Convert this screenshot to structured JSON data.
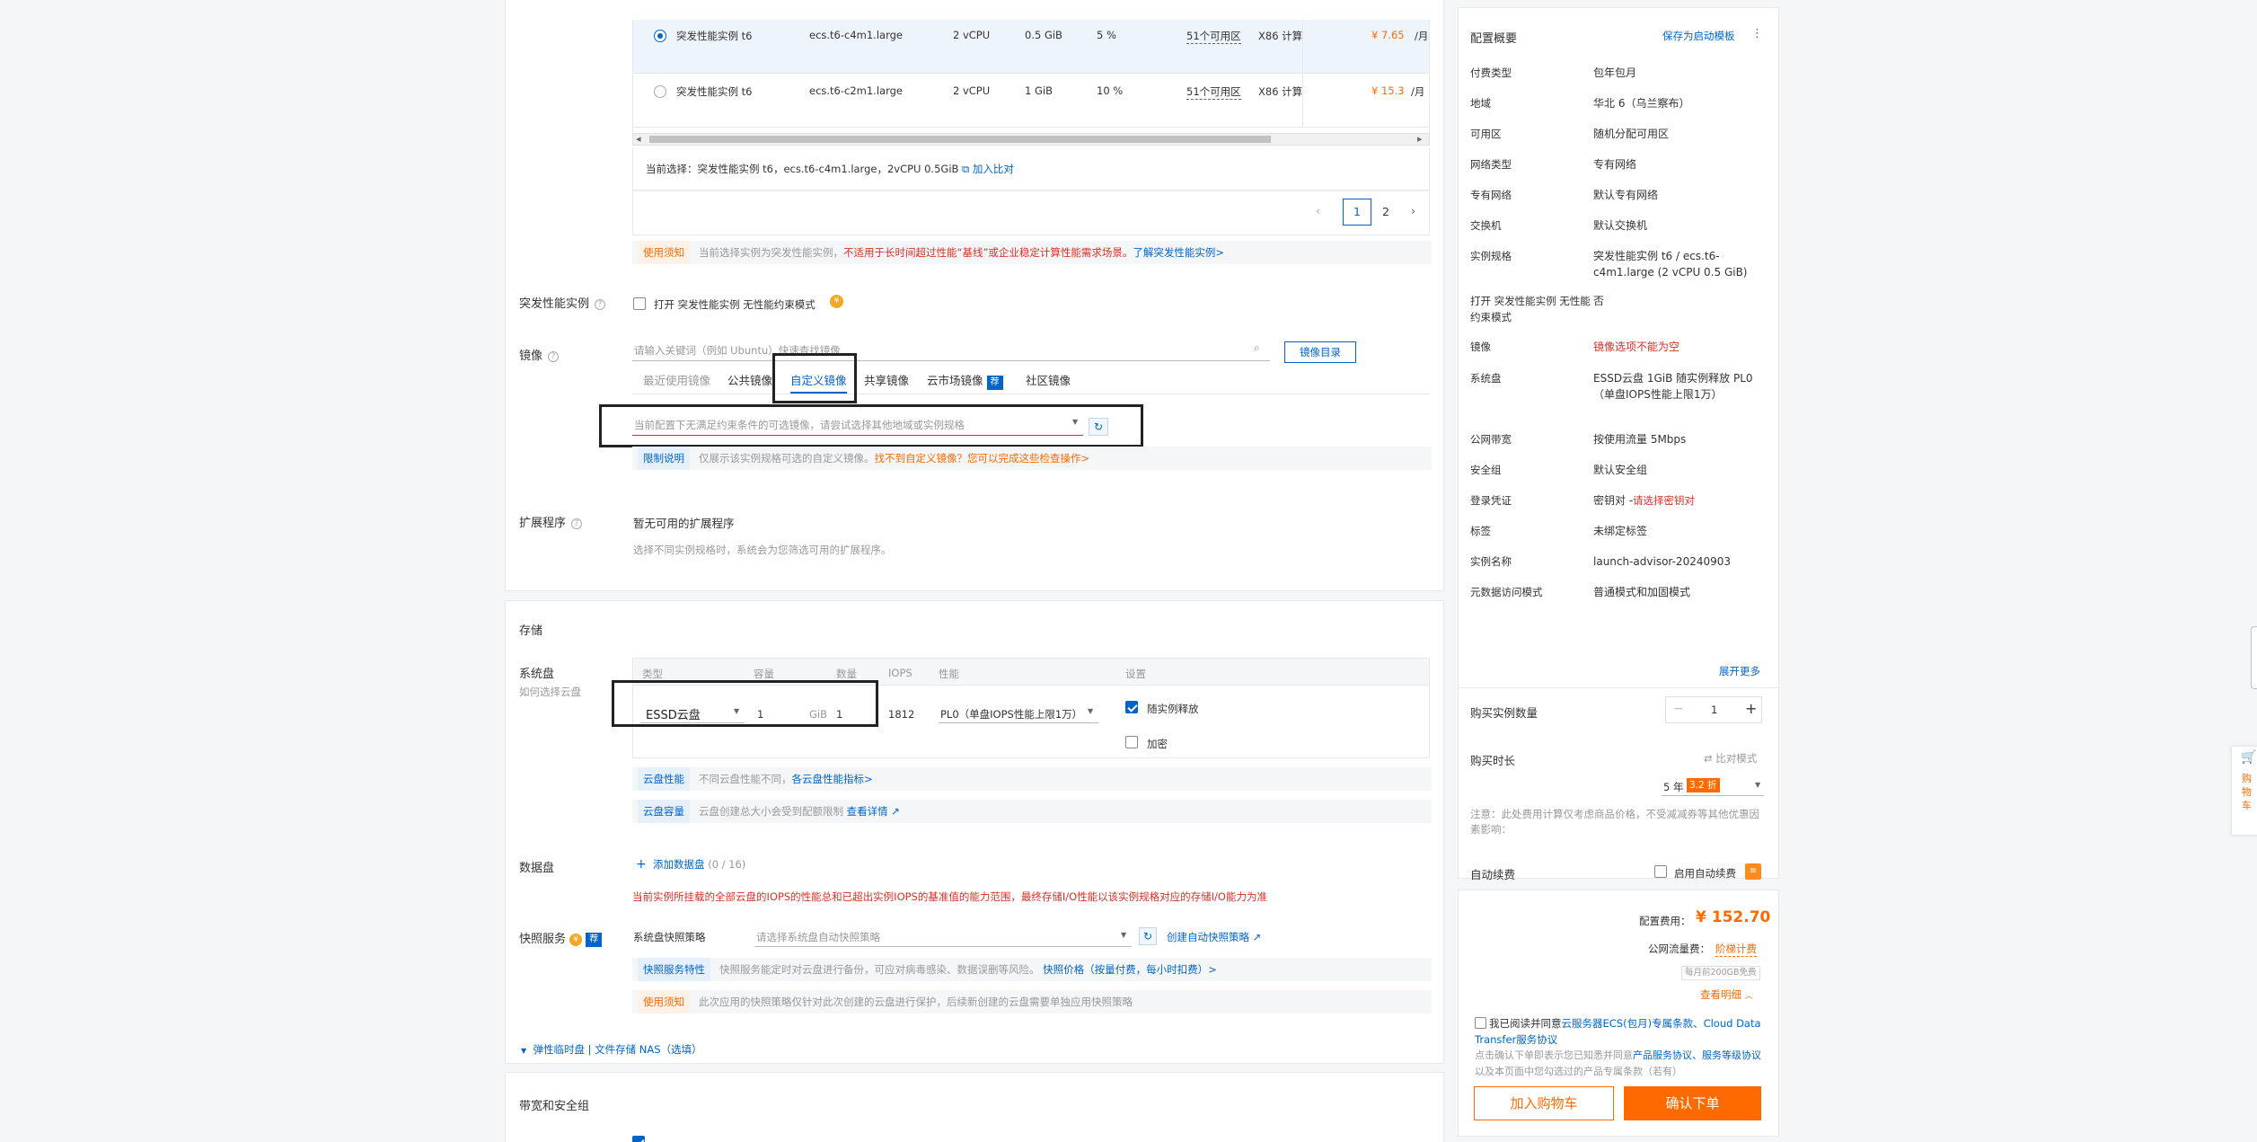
{
  "instance_table": {
    "rows": [
      {
        "family": "突发性能实例 t6",
        "spec": "ecs.t6-c4m1.large",
        "vcpu": "2 vCPU",
        "mem": "0.5 GiB",
        "baseline": "5 %",
        "zones": "51个可用区",
        "arch": "X86 计算",
        "price": "¥ 7.65",
        "unit": "/月",
        "selected": true
      },
      {
        "family": "突发性能实例 t6",
        "spec": "ecs.t6-c2m1.large",
        "vcpu": "2 vCPU",
        "mem": "1 GiB",
        "baseline": "10 %",
        "zones": "51个可用区",
        "arch": "X86 计算",
        "price": "¥ 15.3",
        "unit": "/月",
        "selected": false
      }
    ],
    "current_selection": "当前选择：突发性能实例 t6，ecs.t6-c4m1.large，2vCPU 0.5GiB",
    "add_compare": "加入比对",
    "pages": [
      "1",
      "2"
    ],
    "current_page": "1"
  },
  "notices": {
    "usage_tag": "使用须知",
    "usage_text_1": "当前选择实例为突发性能实例，",
    "usage_text_red": "不适用于长时间超过性能“基线”或企业稳定计算性能需求场景。",
    "usage_link": "了解突发性能实例>"
  },
  "burst": {
    "label": "突发性能实例",
    "checkbox_label": "打开 突发性能实例 无性能约束模式"
  },
  "image": {
    "label": "镜像",
    "search_placeholder": "请输入关键词（例如 Ubuntu）快速查找镜像",
    "catalog_button": "镜像目录",
    "tabs": [
      "最近使用镜像",
      "公共镜像",
      "自定义镜像",
      "共享镜像",
      "云市场镜像",
      "社区镜像"
    ],
    "market_badge": "荐",
    "select_placeholder": "当前配置下无满足约束条件的可选镜像，请尝试选择其他地域或实例规格",
    "limit_tag": "限制说明",
    "limit_text": "仅展示该实例规格可选的自定义镜像。",
    "limit_text_orange": "找不到自定义镜像？您可以完成这些检查操作>"
  },
  "extensions": {
    "label": "扩展程序",
    "title": "暂无可用的扩展程序",
    "desc": "选择不同实例规格时，系统会为您筛选可用的扩展程序。"
  },
  "storage": {
    "title": "存储",
    "system_disk_label": "系统盘",
    "system_disk_help": "如何选择云盘",
    "headers": [
      "类型",
      "容量",
      "数量",
      "IOPS",
      "性能",
      "设置"
    ],
    "disk_type": "ESSD云盘",
    "capacity": "1",
    "capacity_unit": "GiB",
    "count": "1",
    "iops": "1812",
    "perf": "PL0（单盘IOPS性能上限1万）",
    "release_with_instance": "随实例释放",
    "encrypt": "加密",
    "perf_tag": "云盘性能",
    "perf_text": "不同云盘性能不同，",
    "perf_link": "各云盘性能指标>",
    "cap_tag": "云盘容量",
    "cap_text": "云盘创建总大小会受到配额限制",
    "cap_link": "查看详情",
    "data_disk_label": "数据盘",
    "add_data_disk": "添加数据盘",
    "data_disk_count": "(0 / 16)",
    "iops_warning": "当前实例所挂载的全部云盘的IOPS的性能总和已超出实例IOPS的基准值的能力范围，最终存储I/O性能以该实例规格对应的存储I/O能力为准",
    "snapshot_label": "快照服务",
    "snapshot_badge": "荐",
    "snapshot_policy_label": "系统盘快照策略",
    "snapshot_placeholder": "请选择系统盘自动快照策略",
    "create_policy": "创建自动快照策略",
    "snap_tag": "快照服务特性",
    "snap_text": "快照服务能定时对云盘进行备份，可应对病毒感染、数据误删等风险。",
    "snap_link": "快照价格（按量付费，每小时扣费）>",
    "snap_usage_tag": "使用须知",
    "snap_usage_text": "此次应用的快照策略仅针对此次创建的云盘进行保护，后续新创建的云盘需要单独应用快照策略",
    "elastic_toggle": "弹性临时盘 | 文件存储 NAS（选填）"
  },
  "bandwidth": {
    "title": "带宽和安全组"
  },
  "summary": {
    "title": "配置概要",
    "save_template": "保存为启动模板",
    "rows": [
      {
        "k": "付费类型",
        "v": "包年包月"
      },
      {
        "k": "地域",
        "v": "华北 6（乌兰察布）"
      },
      {
        "k": "可用区",
        "v": "随机分配可用区"
      },
      {
        "k": "网络类型",
        "v": "专有网络"
      },
      {
        "k": "专有网络",
        "v": "默认专有网络"
      },
      {
        "k": "交换机",
        "v": "默认交换机"
      },
      {
        "k": "实例规格",
        "v": "突发性能实例 t6 / ecs.t6-c4m1.large (2 vCPU 0.5 GiB)"
      },
      {
        "k": "打开 突发性能实例 无性能约束模式",
        "v": "否"
      },
      {
        "k": "镜像",
        "v": "镜像选项不能为空"
      },
      {
        "k": "系统盘",
        "v": "ESSD云盘 1GiB 随实例释放 PL0（单盘IOPS性能上限1万）"
      },
      {
        "k": "公网带宽",
        "v": "按使用流量 5Mbps"
      },
      {
        "k": "安全组",
        "v": "默认安全组"
      },
      {
        "k": "登录凭证",
        "v": "密钥对 - "
      },
      {
        "k": "标签",
        "v": "未绑定标签"
      },
      {
        "k": "实例名称",
        "v": "launch-advisor-20240903"
      },
      {
        "k": "元数据访问模式",
        "v": "普通模式和加固模式"
      }
    ],
    "login_link": "请选择密钥对",
    "expand_more": "展开更多",
    "qty_label": "购买实例数量",
    "qty_value": "1",
    "duration_label": "购买时长",
    "compare_mode": "比对模式",
    "duration_value": "5 年",
    "discount": "3.2 折",
    "note": "注意：此处费用计算仅考虑商品价格，不受减减券等其他优惠因素影响：",
    "auto_renew_label": "自动续费",
    "auto_renew_check": "启用自动续费",
    "config_fee_label": "配置费用：",
    "config_fee": "¥ 152.70",
    "traffic_fee_label": "公网流量费：",
    "traffic_fee": "阶梯计费",
    "free_quota": "每月前200GB免费",
    "view_detail": "查看明细",
    "agreement_1": "我已阅读并同意",
    "agreement_link": "云服务器ECS(包月)专属条款、Cloud Data Transfer服务协议",
    "agreement_2": "点击确认下单即表示您已知悉并同意",
    "agreement_link2": "产品服务协议、服务等级协议",
    "agreement_3": "以及本页面中您勾选过的产品专属条款（若有）",
    "add_cart": "加入购物车",
    "confirm": "确认下单"
  },
  "cart_float": "购物车",
  "colors": {
    "accent": "#0064c8",
    "orange": "#ff6a00",
    "red": "#d93026"
  }
}
